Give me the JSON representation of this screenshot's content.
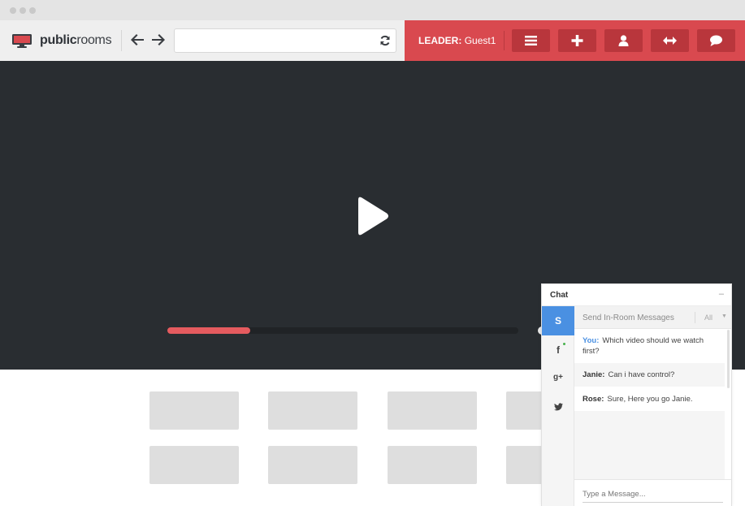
{
  "app": {
    "logo_bold": "public",
    "logo_light": "rooms"
  },
  "toolbar": {
    "url_value": "",
    "leader_label": "LEADER:",
    "leader_name": "Guest1",
    "buttons": [
      {
        "icon": "menu-icon"
      },
      {
        "icon": "plus-icon"
      },
      {
        "icon": "user-icon"
      },
      {
        "icon": "resize-icon"
      },
      {
        "icon": "chat-bubble-icon"
      }
    ]
  },
  "player": {
    "progress": 0.236,
    "accent": "#e55b5f"
  },
  "thumbnails": {
    "rows": 2,
    "visible_per_row": 4
  },
  "chat": {
    "title": "Chat",
    "minimize": "–",
    "send_placeholder": "Send In-Room Messages",
    "filter": "All",
    "networks": [
      {
        "label": "S",
        "name": "in-room"
      },
      {
        "label": "f",
        "name": "facebook"
      },
      {
        "label": "g+",
        "name": "google-plus"
      },
      {
        "label": "t",
        "name": "twitter"
      }
    ],
    "messages": [
      {
        "author": "You:",
        "text": "Which video should we watch first?"
      },
      {
        "author": "Janie:",
        "text": "Can i have control?"
      },
      {
        "author": "Rose:",
        "text": "Sure, Here you go Janie."
      }
    ],
    "input_placeholder": "Type a Message..."
  },
  "colors": {
    "brand_red": "#d9494f",
    "button_red": "#b9363c",
    "video_bg": "#292d31",
    "chat_active": "#4a90e2"
  }
}
